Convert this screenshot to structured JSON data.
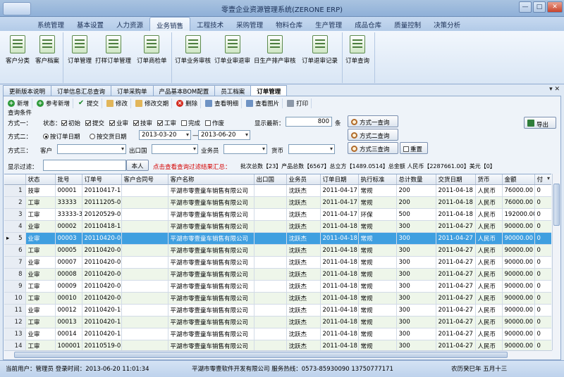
{
  "window": {
    "title": "零壹企业资源管理系统(ZERONE ERP)",
    "controls": [
      "—",
      "□",
      "✕"
    ]
  },
  "menu": [
    "系统管理",
    "基本设置",
    "人力资源",
    "业务销售",
    "工程技术",
    "采购管理",
    "物料仓库",
    "生产管理",
    "成品仓库",
    "质量控制",
    "决策分析"
  ],
  "active_menu": "业务销售",
  "ribbon": {
    "group1": [
      "客户分类",
      "客户档案"
    ],
    "group2": [
      "订单管理",
      "打样订单管理",
      "订单商检单"
    ],
    "group3": [
      "订单业务审核",
      "订单业审退审",
      "日生产排产审核",
      "订单退审记录"
    ],
    "group4": [
      "订单查询"
    ]
  },
  "doc_tabs": [
    "更新版本说明",
    "订单信息汇总查询",
    "订单采购单",
    "产品基本BOM配置",
    "员工档案",
    "订单管理"
  ],
  "active_doc_tab": "订单管理",
  "tab_controls": "▾ ✕",
  "toolbar": {
    "new": "新增",
    "ref_new": "参考新增",
    "submit": "提交",
    "edit": "修改",
    "edit_date": "修改交期",
    "delete": "删除",
    "view_detail": "查看明细",
    "view_image": "查看图片",
    "print": "打印"
  },
  "query": {
    "section_title": "查询条件",
    "mode1_label": "方式一：",
    "status_label": "状态：",
    "status_options": [
      {
        "label": "初始",
        "checked": true
      },
      {
        "label": "提交",
        "checked": true
      },
      {
        "label": "业审",
        "checked": true
      },
      {
        "label": "技审",
        "checked": true
      },
      {
        "label": "工审",
        "checked": true
      },
      {
        "label": "完成",
        "checked": false
      },
      {
        "label": "作废",
        "checked": false
      }
    ],
    "latest_label": "显示最新：",
    "latest_value": "800",
    "latest_unit": "条",
    "mode1_button": "方式一查询",
    "export_button": "导出",
    "mode2_label": "方式二：",
    "by_order_date": "按订单日期",
    "by_delivery_date": "按交货日期",
    "date_from": "2013-03-20",
    "date_sep": "—",
    "date_to": "2013-06-20",
    "mode2_button": "方式二查询",
    "mode3_label": "方式三：",
    "customer_label": "客户",
    "exit_country_label": "出口国",
    "salesman_label": "业务员",
    "currency_label": "货币",
    "mode3_button": "方式三查询",
    "reset_button": "重置",
    "filter_label": "显示过滤：",
    "filter_value": "",
    "self_button": "本人",
    "filter_hint": "点击查看查询过滤结果汇总：",
    "summary": "批次总数【23】产品总数【6567】总立方【1489.0514】总金额 人民币【2287661.00】美元【0】"
  },
  "table": {
    "columns": [
      "",
      "状态",
      "批号",
      "订单号",
      "客户合同号",
      "客户名称",
      "出口国",
      "业务员",
      "订单日期",
      "执行标准",
      "总计数量",
      "交货日期",
      "货币",
      "金额",
      "付"
    ],
    "selected_row": 4,
    "rows": [
      [
        "1",
        "技审",
        "00001",
        "20110417-1",
        "",
        "平湖市零壹童车销售有限公司",
        "",
        "沈跃杰",
        "2011-04-17",
        "常规",
        "200",
        "2011-04-18",
        "人民币",
        "76000.00",
        "0"
      ],
      [
        "2",
        "工审",
        "33333",
        "20111205-01",
        "",
        "平湖市零壹童车销售有限公司",
        "",
        "沈跃杰",
        "2011-04-17",
        "常规",
        "200",
        "2011-04-18",
        "人民币",
        "76000.00",
        "0"
      ],
      [
        "3",
        "工审",
        "33333-3",
        "20120529-02",
        "",
        "平湖市零壹童车销售有限公司",
        "",
        "沈跃杰",
        "2011-04-17",
        "环保",
        "500",
        "2011-04-18",
        "人民币",
        "192000.00",
        "0"
      ],
      [
        "4",
        "业审",
        "00002",
        "20110418-1",
        "",
        "平湖市零壹童车销售有限公司",
        "",
        "沈跃杰",
        "2011-04-18",
        "常规",
        "300",
        "2011-04-27",
        "人民币",
        "90000.00",
        "0"
      ],
      [
        "5",
        "业审",
        "00003",
        "20110420-01",
        "",
        "平湖市零壹童车销售有限公司",
        "",
        "沈跃杰",
        "2011-04-18",
        "常规",
        "300",
        "2011-04-27",
        "人民币",
        "90000.00",
        "0"
      ],
      [
        "6",
        "工审",
        "00005",
        "20110420-03",
        "",
        "平湖市零壹童车销售有限公司",
        "",
        "沈跃杰",
        "2011-04-18",
        "常规",
        "300",
        "2011-04-27",
        "人民币",
        "90000.00",
        "0"
      ],
      [
        "7",
        "业审",
        "00007",
        "20110420-05",
        "",
        "平湖市零壹童车销售有限公司",
        "",
        "沈跃杰",
        "2011-04-18",
        "常规",
        "300",
        "2011-04-27",
        "人民币",
        "90000.00",
        "0"
      ],
      [
        "8",
        "业审",
        "00008",
        "20110420-06",
        "",
        "平湖市零壹童车销售有限公司",
        "",
        "沈跃杰",
        "2011-04-18",
        "常规",
        "300",
        "2011-04-27",
        "人民币",
        "90000.00",
        "0"
      ],
      [
        "9",
        "工审",
        "00009",
        "20110420-07",
        "",
        "平湖市零壹童车销售有限公司",
        "",
        "沈跃杰",
        "2011-04-18",
        "常规",
        "300",
        "2011-04-27",
        "人民币",
        "90000.00",
        "0"
      ],
      [
        "10",
        "工审",
        "00010",
        "20110420-08",
        "",
        "平湖市零壹童车销售有限公司",
        "",
        "沈跃杰",
        "2011-04-18",
        "常规",
        "300",
        "2011-04-27",
        "人民币",
        "90000.00",
        "0"
      ],
      [
        "11",
        "业审",
        "00012",
        "20110420-10",
        "",
        "平湖市零壹童车销售有限公司",
        "",
        "沈跃杰",
        "2011-04-18",
        "常规",
        "300",
        "2011-04-27",
        "人民币",
        "90000.00",
        "0"
      ],
      [
        "12",
        "工审",
        "00013",
        "20110420-11",
        "",
        "平湖市零壹童车销售有限公司",
        "",
        "沈跃杰",
        "2011-04-18",
        "常规",
        "300",
        "2011-04-27",
        "人民币",
        "90000.00",
        "0"
      ],
      [
        "13",
        "业审",
        "00014",
        "20110420-12",
        "",
        "平湖市零壹童车销售有限公司",
        "",
        "沈跃杰",
        "2011-04-18",
        "常规",
        "300",
        "2011-04-27",
        "人民币",
        "90000.00",
        "0"
      ],
      [
        "14",
        "工审",
        "100001",
        "20110519-01",
        "",
        "平湖市零壹童车销售有限公司",
        "",
        "沈跃杰",
        "2011-04-18",
        "常规",
        "300",
        "2011-04-27",
        "人民币",
        "90000.00",
        "0"
      ]
    ]
  },
  "statusbar": {
    "user": "当前用户：管理员 登录时间：2013-06-20 11:01:34",
    "company": "平湖市零壹软件开发有限公司 服务热线：0573-85930090 13750777171",
    "lunar": "农历癸巳年 五月十三"
  },
  "colors": {
    "selected_row": "#3f9fe0",
    "alt_row": "#eef6ea",
    "hint_red": "#d40000"
  },
  "icons": [
    "add-icon",
    "ref-add-icon",
    "submit-check-icon",
    "edit-icon",
    "edit-date-icon",
    "delete-icon",
    "view-detail-icon",
    "view-image-icon",
    "print-icon",
    "search-icon",
    "export-icon",
    "reset-icon",
    "row-pointer-icon"
  ]
}
